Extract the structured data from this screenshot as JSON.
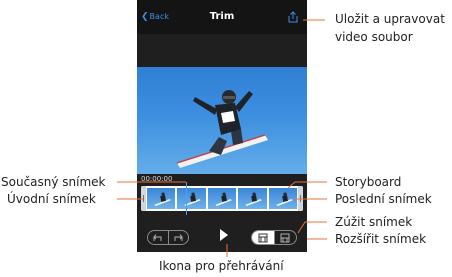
{
  "nav": {
    "back_label": "Back",
    "title": "Trim"
  },
  "timecode": "00:00:00",
  "storyboard": {
    "frame_count": 5
  },
  "colors": {
    "accent": "#3a8ee6",
    "leader": "#e8733a",
    "sky": "#3d8fe0"
  },
  "icons": {
    "share": "share-icon",
    "rotate_left": "rotate-left-icon",
    "rotate_right": "rotate-right-icon",
    "play": "play-icon",
    "trim_narrow": "trim-narrow-icon",
    "trim_widen": "trim-widen-icon"
  },
  "callouts": {
    "save_line1": "Uložit a upravovat",
    "save_line2": "video soubor",
    "current_frame": "Současný snímek",
    "first_frame": "Úvodní snímek",
    "storyboard": "Storyboard",
    "last_frame": "Poslední snímek",
    "narrow_frame": "Zúžit snímek",
    "widen_frame": "Rozšířit snímek",
    "play_icon": "Ikona pro přehrávání"
  }
}
